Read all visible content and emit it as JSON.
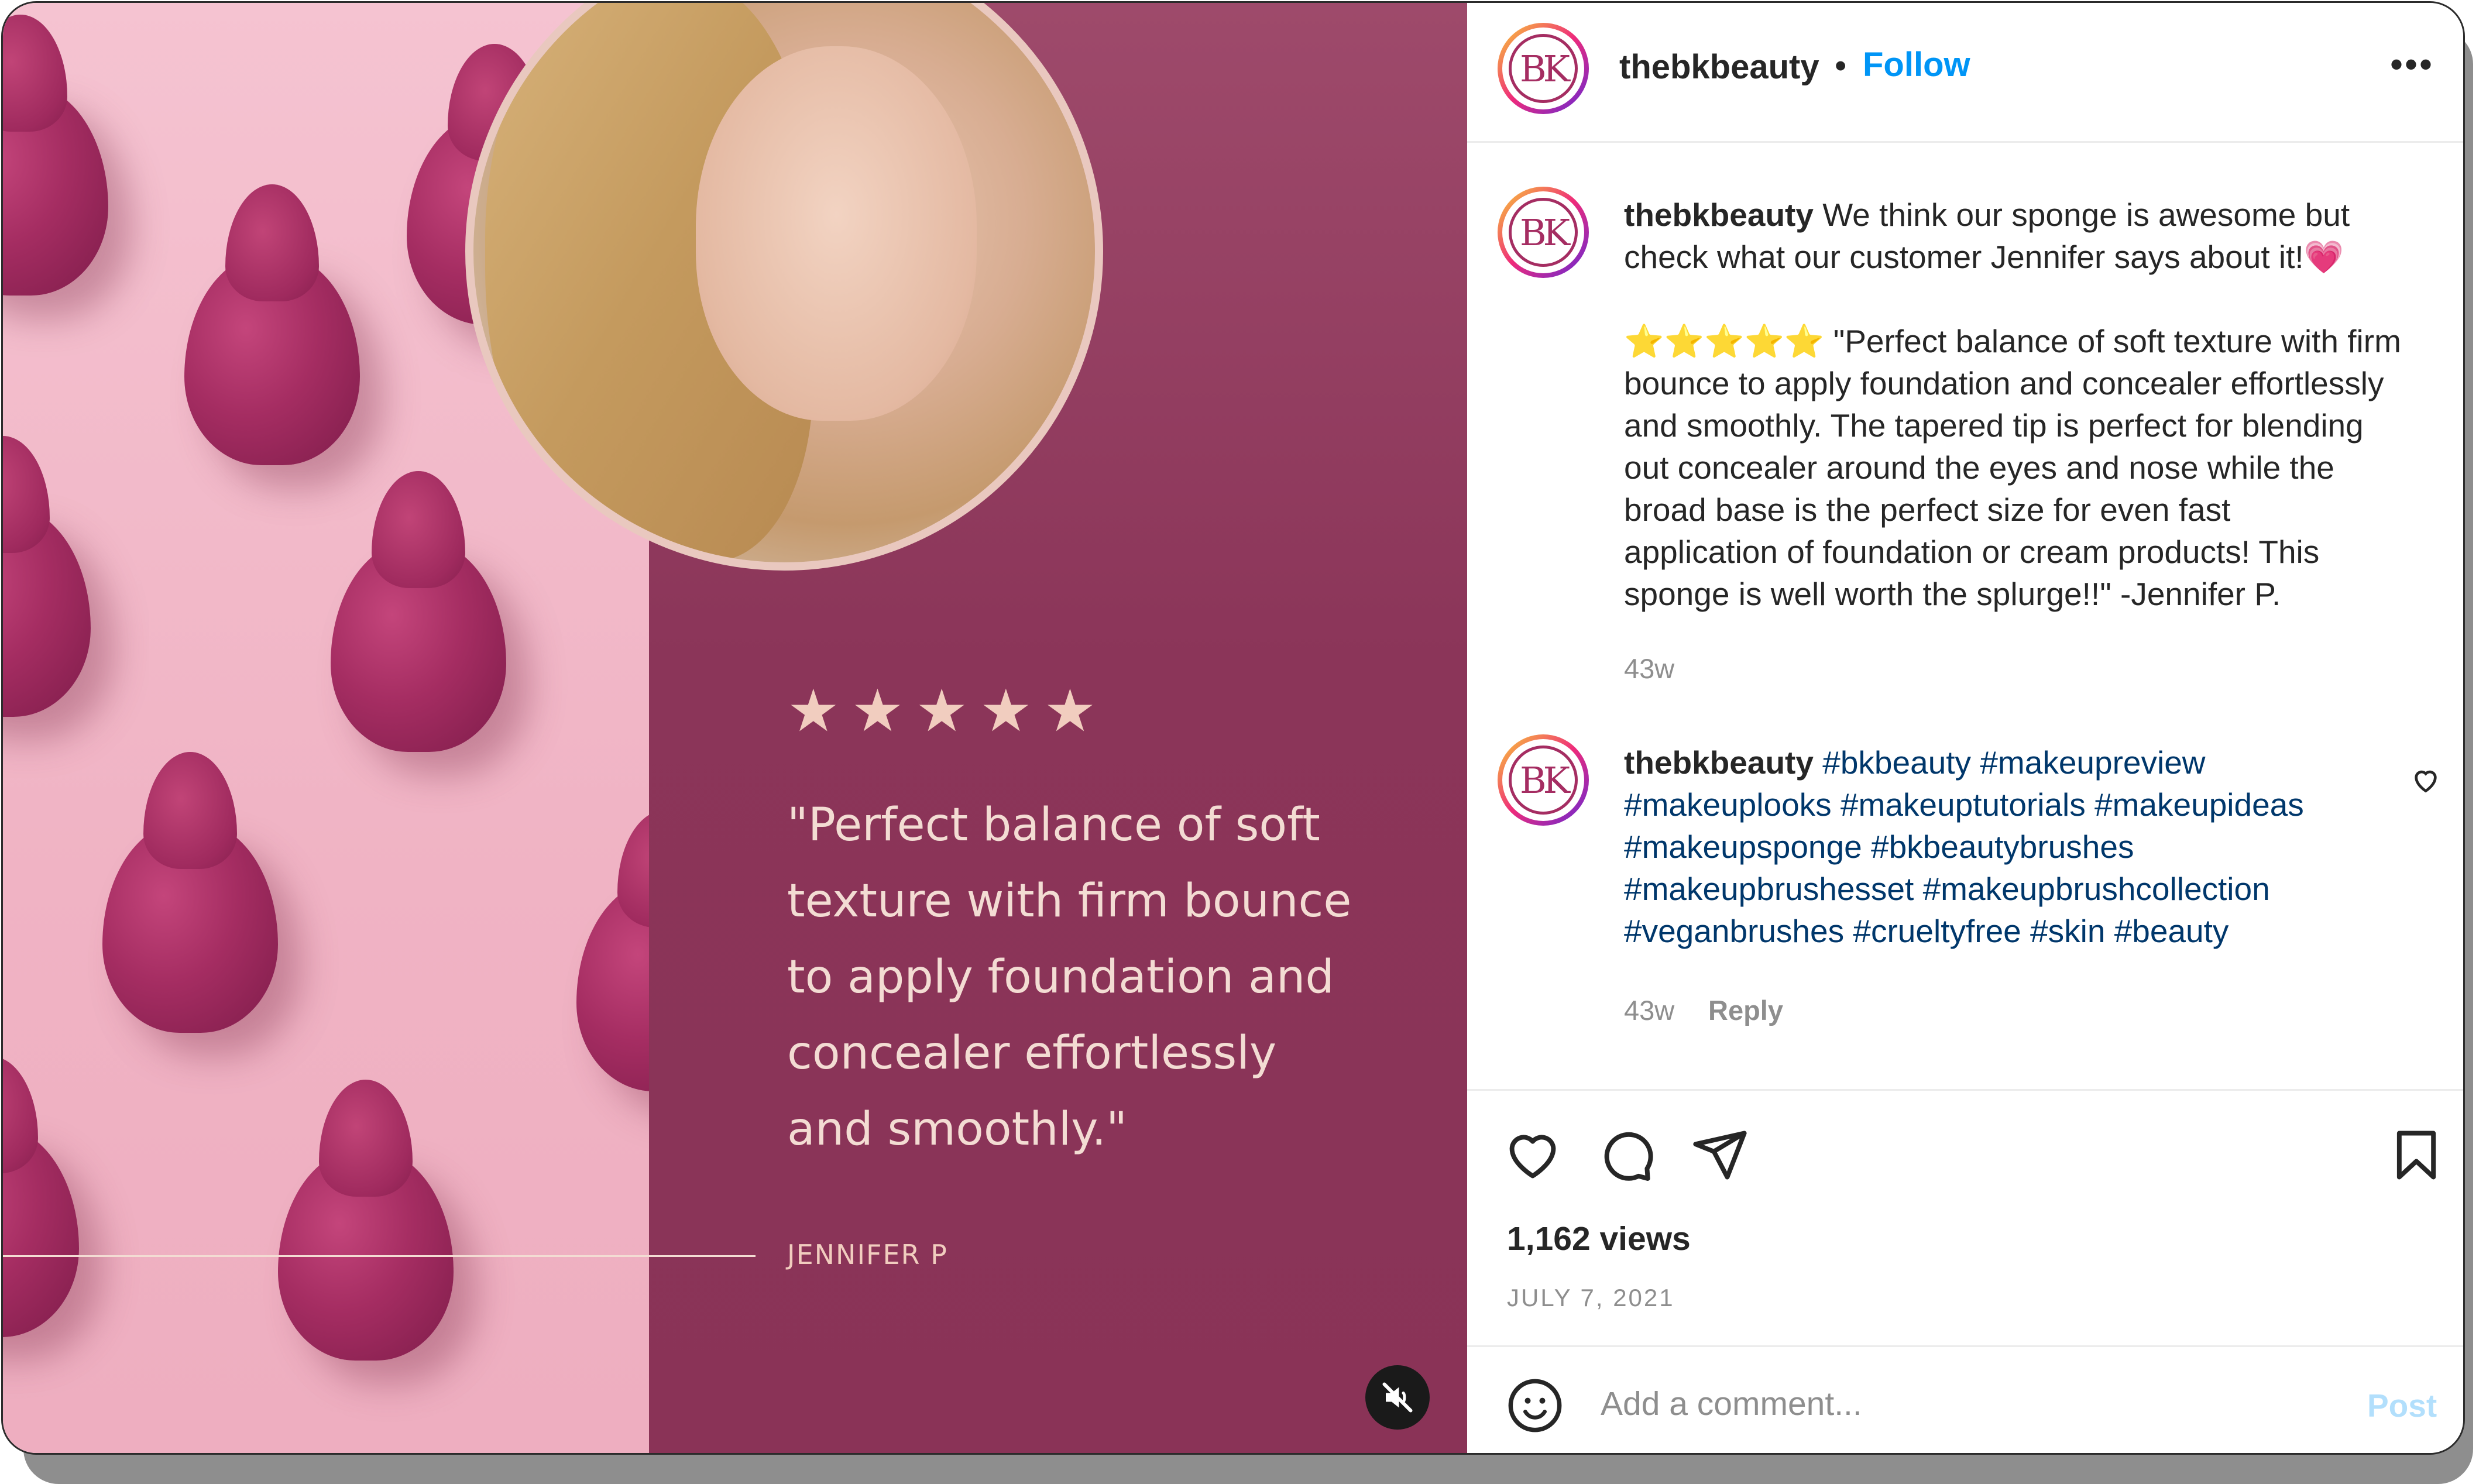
{
  "media": {
    "rating_stars": [
      "★",
      "★",
      "★",
      "★",
      "★"
    ],
    "quote_lines": [
      "\"Perfect balance of soft",
      "texture with firm bounce",
      "to apply foundation and",
      "concealer effortlessly",
      "and smoothly.\""
    ],
    "attribution": "JENNIFER P",
    "mute_icon": "muted-speaker-icon"
  },
  "header": {
    "avatar_text": "BK",
    "username": "thebkbeauty",
    "separator": "•",
    "follow_label": "Follow",
    "more_label": "•••"
  },
  "comments": [
    {
      "avatar_text": "BK",
      "username": "thebkbeauty",
      "lines": [
        " We think our sponge is awesome but",
        "check what our customer Jennifer says about it!💗",
        "",
        "⭐⭐⭐⭐⭐ \"Perfect balance of soft texture with firm",
        "bounce to apply foundation and concealer effortlessly",
        "and smoothly. The tapered tip is perfect for blending",
        "out concealer around the eyes and nose while the",
        "broad base is the perfect size for even fast",
        "application of foundation or cream products! This",
        "sponge is well worth the splurge!!\" -Jennifer P."
      ],
      "time": "43w"
    },
    {
      "avatar_text": "BK",
      "username": "thebkbeauty",
      "lines": [
        " #bkbeauty #makeupreview",
        "#makeuplooks #makeuptutorials #makeupideas",
        "#makeupsponge #bkbeautybrushes",
        "#makeupbrushesset #makeupbrushcollection",
        "#veganbrushes #crueltyfree #skin #beauty"
      ],
      "time": "43w",
      "reply_label": "Reply"
    }
  ],
  "actions": {
    "icons": [
      "heart-icon",
      "comment-icon",
      "share-icon",
      "bookmark-icon"
    ],
    "views": "1,162 views",
    "date": "JULY 7, 2021"
  },
  "add_comment": {
    "placeholder": "Add a comment...",
    "post_label": "Post"
  },
  "colors": {
    "follow": "#0095f6",
    "hashtag": "#00376b",
    "brand": "#a52d62",
    "maroon_panel": "#8b3559",
    "pink_panel": "#f2b6c6"
  }
}
